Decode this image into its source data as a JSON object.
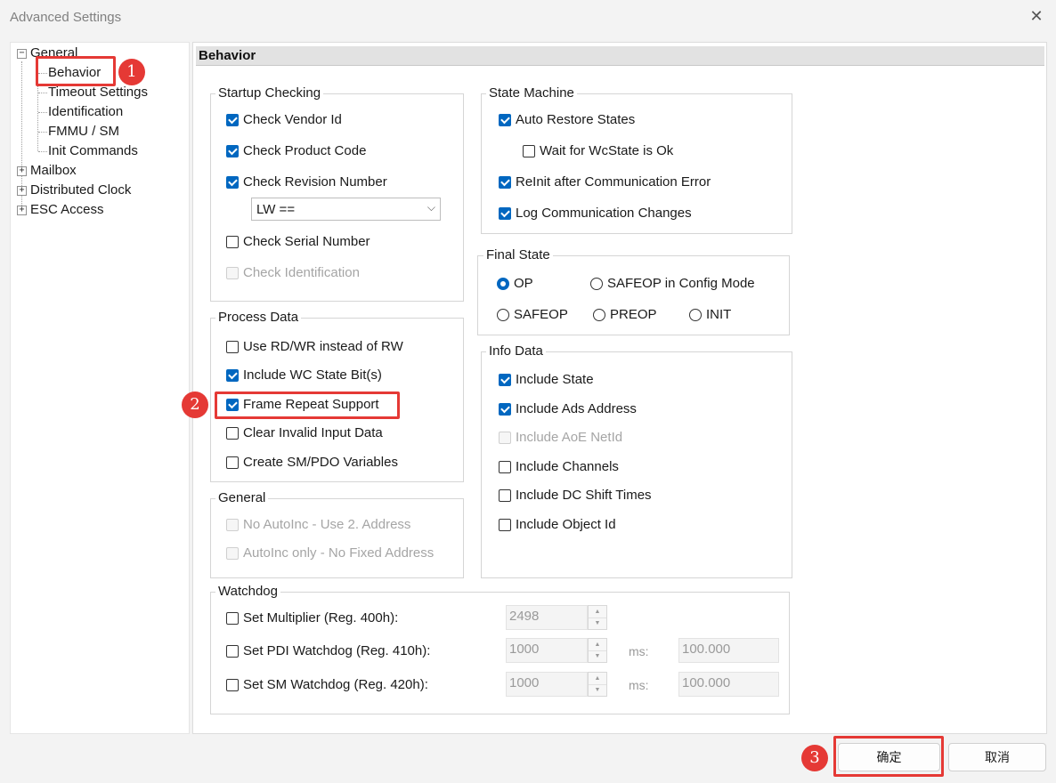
{
  "window": {
    "title": "Advanced Settings"
  },
  "tree": {
    "general": "General",
    "behavior": "Behavior",
    "timeout": "Timeout Settings",
    "identification": "Identification",
    "fmmu": "FMMU / SM",
    "init": "Init Commands",
    "mailbox": "Mailbox",
    "dc": "Distributed Clock",
    "esc": "ESC Access",
    "collapse_glyph": "−",
    "expand_glyph": "+"
  },
  "section": {
    "title": "Behavior"
  },
  "startup": {
    "legend": "Startup Checking",
    "vendor": "Check Vendor Id",
    "product": "Check Product Code",
    "revision": "Check Revision Number",
    "revision_mode": "LW ==",
    "serial": "Check Serial Number",
    "ident": "Check Identification"
  },
  "process": {
    "legend": "Process Data",
    "rdwr": "Use RD/WR instead of RW",
    "wc": "Include WC State Bit(s)",
    "frame": "Frame Repeat Support",
    "clear": "Clear Invalid Input Data",
    "create": "Create SM/PDO Variables"
  },
  "generalgrp": {
    "legend": "General",
    "noautoinc": "No AutoInc - Use 2. Address",
    "autoinc": "AutoInc only - No Fixed Address"
  },
  "statemachine": {
    "legend": "State Machine",
    "auto": "Auto Restore States",
    "wait": "Wait for WcState is Ok",
    "reinit": "ReInit after Communication Error",
    "log": "Log Communication Changes"
  },
  "finalstate": {
    "legend": "Final State",
    "op": "OP",
    "safeop_cfg": "SAFEOP in Config Mode",
    "safeop": "SAFEOP",
    "preop": "PREOP",
    "init": "INIT"
  },
  "info": {
    "legend": "Info Data",
    "state": "Include State",
    "ads": "Include Ads Address",
    "aoe": "Include AoE NetId",
    "channels": "Include Channels",
    "dc": "Include DC Shift Times",
    "objid": "Include Object Id"
  },
  "watchdog": {
    "legend": "Watchdog",
    "mult": "Set Multiplier (Reg. 400h):",
    "mult_val": "2498",
    "pdi": "Set PDI Watchdog (Reg. 410h):",
    "pdi_val": "1000",
    "pdi_ms_label": "ms:",
    "pdi_ms": "100.000",
    "sm": "Set SM Watchdog (Reg. 420h):",
    "sm_val": "1000",
    "sm_ms_label": "ms:",
    "sm_ms": "100.000",
    "up_glyph": "▲",
    "down_glyph": "▼"
  },
  "buttons": {
    "ok": "确定",
    "cancel": "取消"
  },
  "annotations": {
    "one": "1",
    "two": "2",
    "three": "3"
  },
  "icons": {
    "close": "✕",
    "dropdown": "⌵"
  },
  "colors": {
    "accent": "#0067c0",
    "annotation": "#e53935"
  }
}
